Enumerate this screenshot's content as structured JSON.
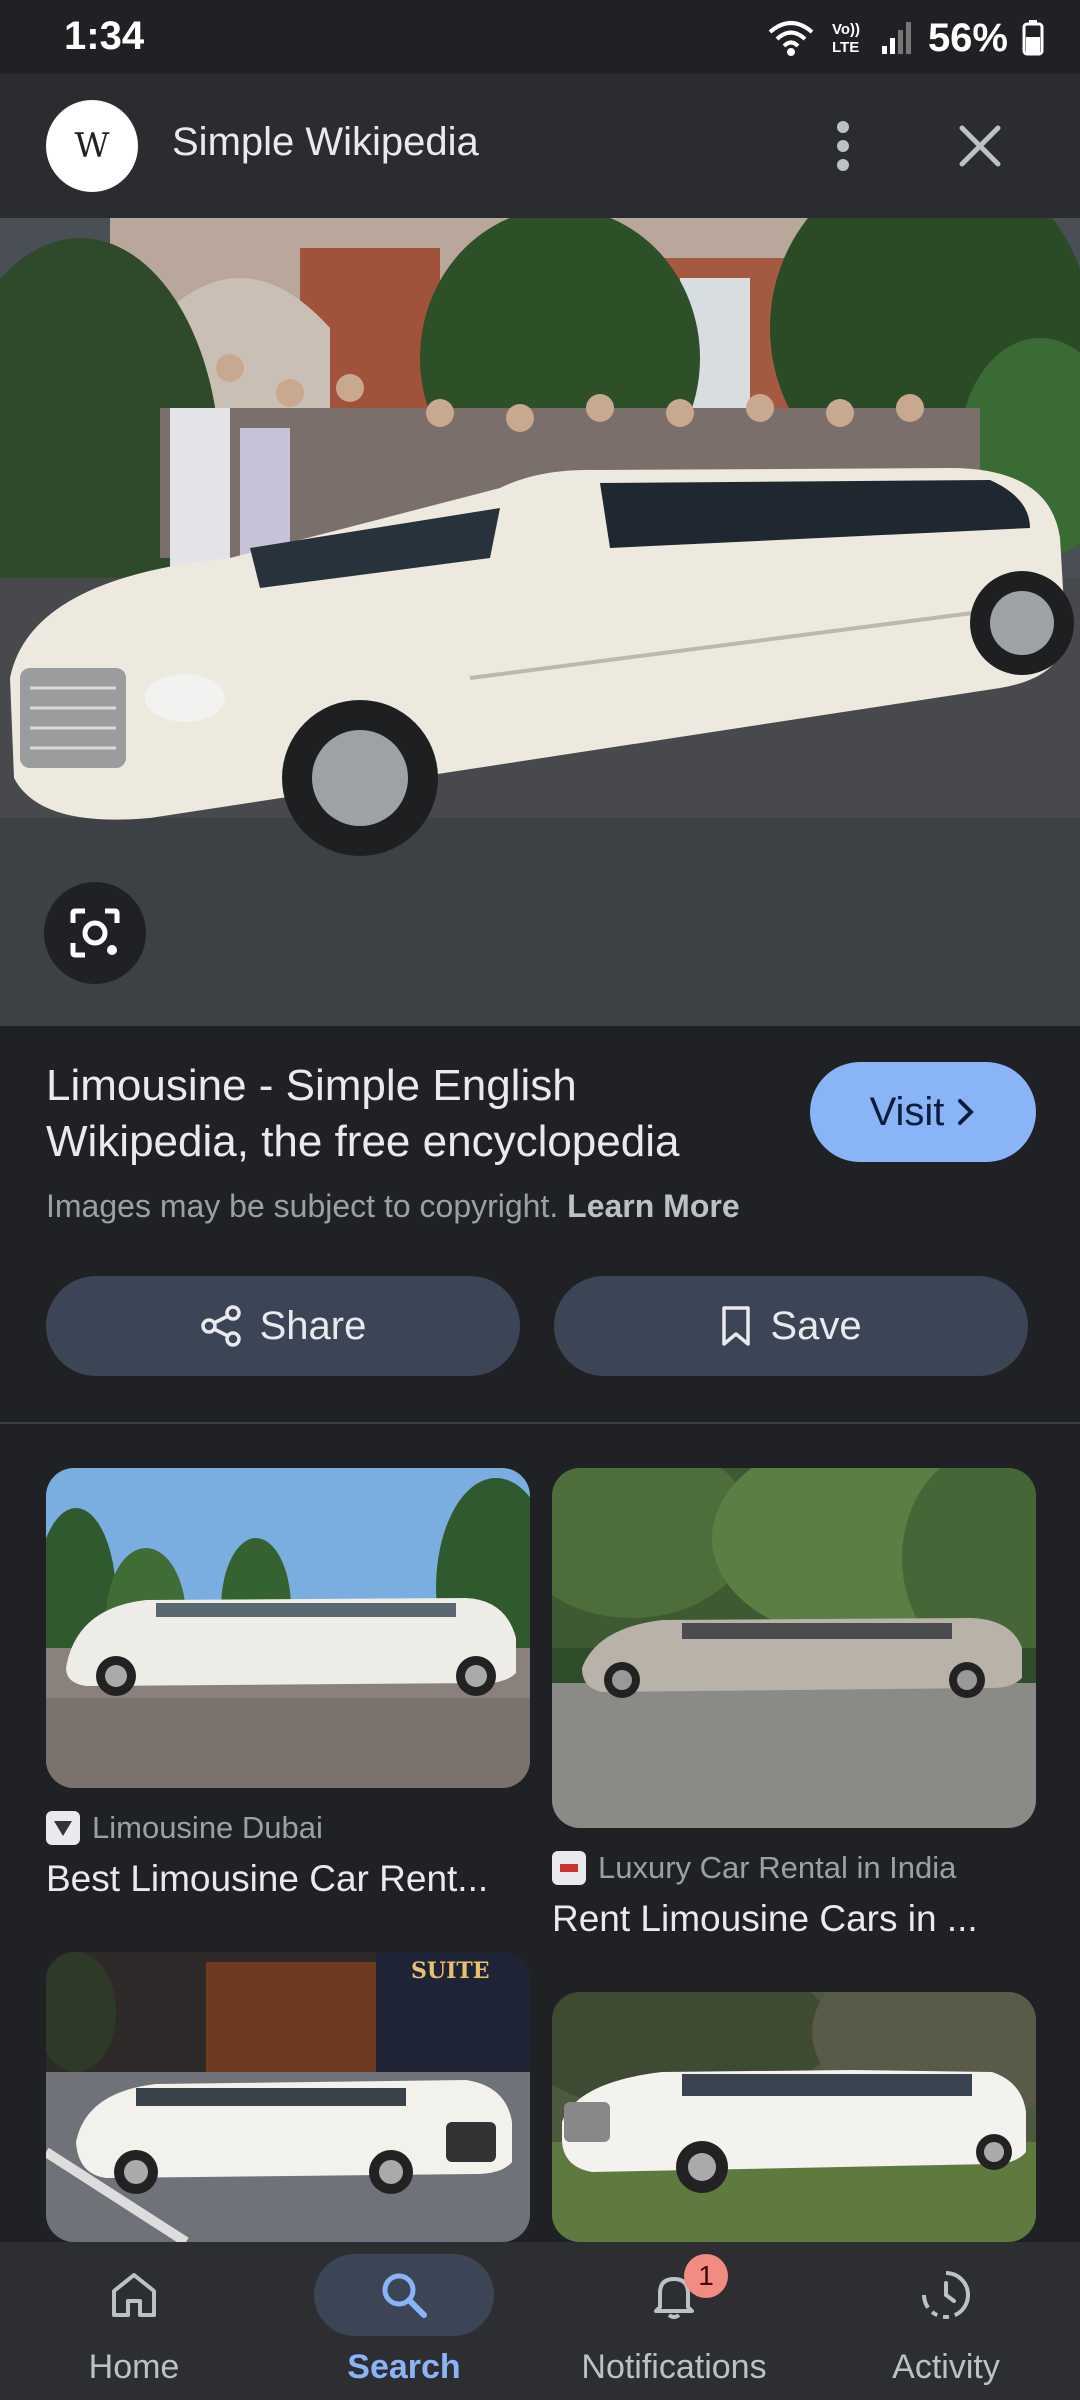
{
  "status_bar": {
    "time": "1:34",
    "battery": "56%",
    "network_label": "Vo)) LTE"
  },
  "header": {
    "logo_text": "W",
    "site_name": "Simple Wikipedia"
  },
  "result": {
    "title": "Limousine - Simple English Wikipedia, the free encyclopedia",
    "visit_label": "Visit",
    "copyright_text": "Images may be subject to copyright.",
    "learn_more": "Learn More",
    "share_label": "Share",
    "save_label": "Save"
  },
  "related": [
    {
      "source": "Limousine Dubai",
      "title": "Best Limousine Car Rent..."
    },
    {
      "source": "Luxury Car Rental in India",
      "title": "Rent Limousine Cars in ..."
    },
    {
      "source": "",
      "title": ""
    },
    {
      "source": "",
      "title": ""
    }
  ],
  "nav": {
    "items": [
      {
        "label": "Home",
        "icon": "home-icon",
        "active": false
      },
      {
        "label": "Search",
        "icon": "search-icon",
        "active": true
      },
      {
        "label": "Notifications",
        "icon": "bell-icon",
        "active": false,
        "badge": "1"
      },
      {
        "label": "Activity",
        "icon": "activity-icon",
        "active": false
      }
    ]
  },
  "colors": {
    "background": "#202124",
    "accent": "#8ab4f8",
    "button_bg": "#3c4556",
    "badge": "#f28b82"
  }
}
